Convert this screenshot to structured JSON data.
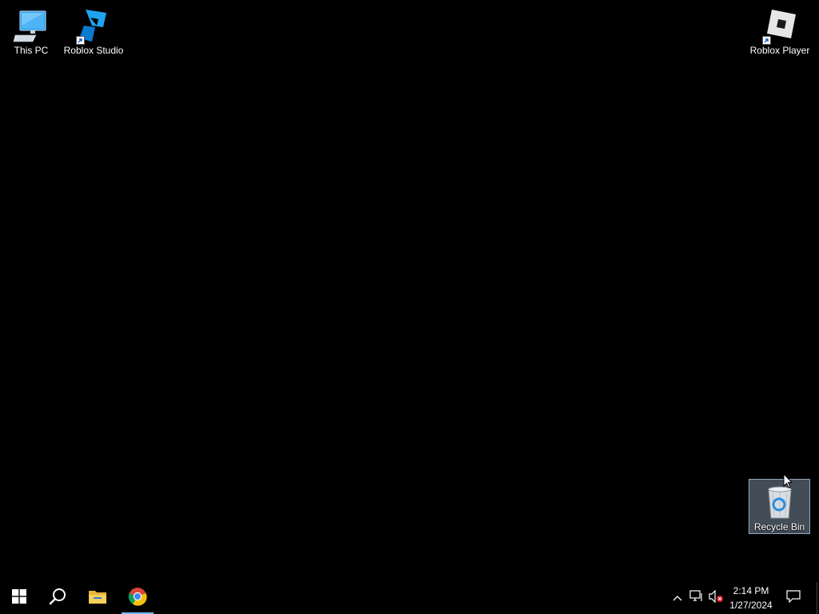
{
  "desktop": {
    "background_color": "#000000",
    "icons": [
      {
        "label": "This PC",
        "icon": "computer-icon",
        "shortcut": false
      },
      {
        "label": "Roblox Studio",
        "icon": "roblox-studio-icon",
        "shortcut": true
      },
      {
        "label": "Roblox Player",
        "icon": "roblox-player-icon",
        "shortcut": true
      },
      {
        "label": "Recycle Bin",
        "icon": "recycle-bin-icon",
        "shortcut": false,
        "selected": true
      }
    ]
  },
  "taskbar": {
    "background_color": "#000000",
    "accent_color": "#76b9ed",
    "pinned": [
      {
        "name": "start",
        "icon": "windows-logo-icon"
      },
      {
        "name": "search",
        "icon": "search-icon"
      },
      {
        "name": "file-explorer",
        "icon": "folder-icon"
      },
      {
        "name": "chrome",
        "icon": "chrome-icon",
        "active": true
      }
    ],
    "tray": {
      "icons": [
        "chevron-up-icon",
        "network-icon",
        "volume-muted-icon"
      ],
      "time": "2:14 PM",
      "date": "1/27/2024",
      "notification_icon": "notification-icon"
    }
  }
}
